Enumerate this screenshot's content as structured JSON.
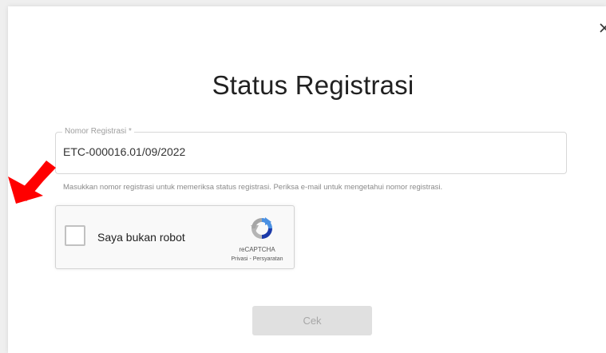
{
  "dialog": {
    "title": "Status Registrasi",
    "close_icon": "close-icon"
  },
  "registration_field": {
    "label": "Nomor Registrasi *",
    "value": "ETC-000016.01/09/2022",
    "hint": "Masukkan nomor registrasi untuk memeriksa status registrasi. Periksa e-mail untuk mengetahui nomor registrasi."
  },
  "recaptcha": {
    "checkbox_label": "Saya bukan robot",
    "brand": "reCAPTCHA",
    "privacy_link": "Privasi",
    "separator": "-",
    "terms_link": "Persyaratan",
    "checked": false
  },
  "submit_button": {
    "label": "Cek",
    "disabled": true
  },
  "annotation": {
    "icon": "red-arrow-icon",
    "color": "#ff0000"
  }
}
